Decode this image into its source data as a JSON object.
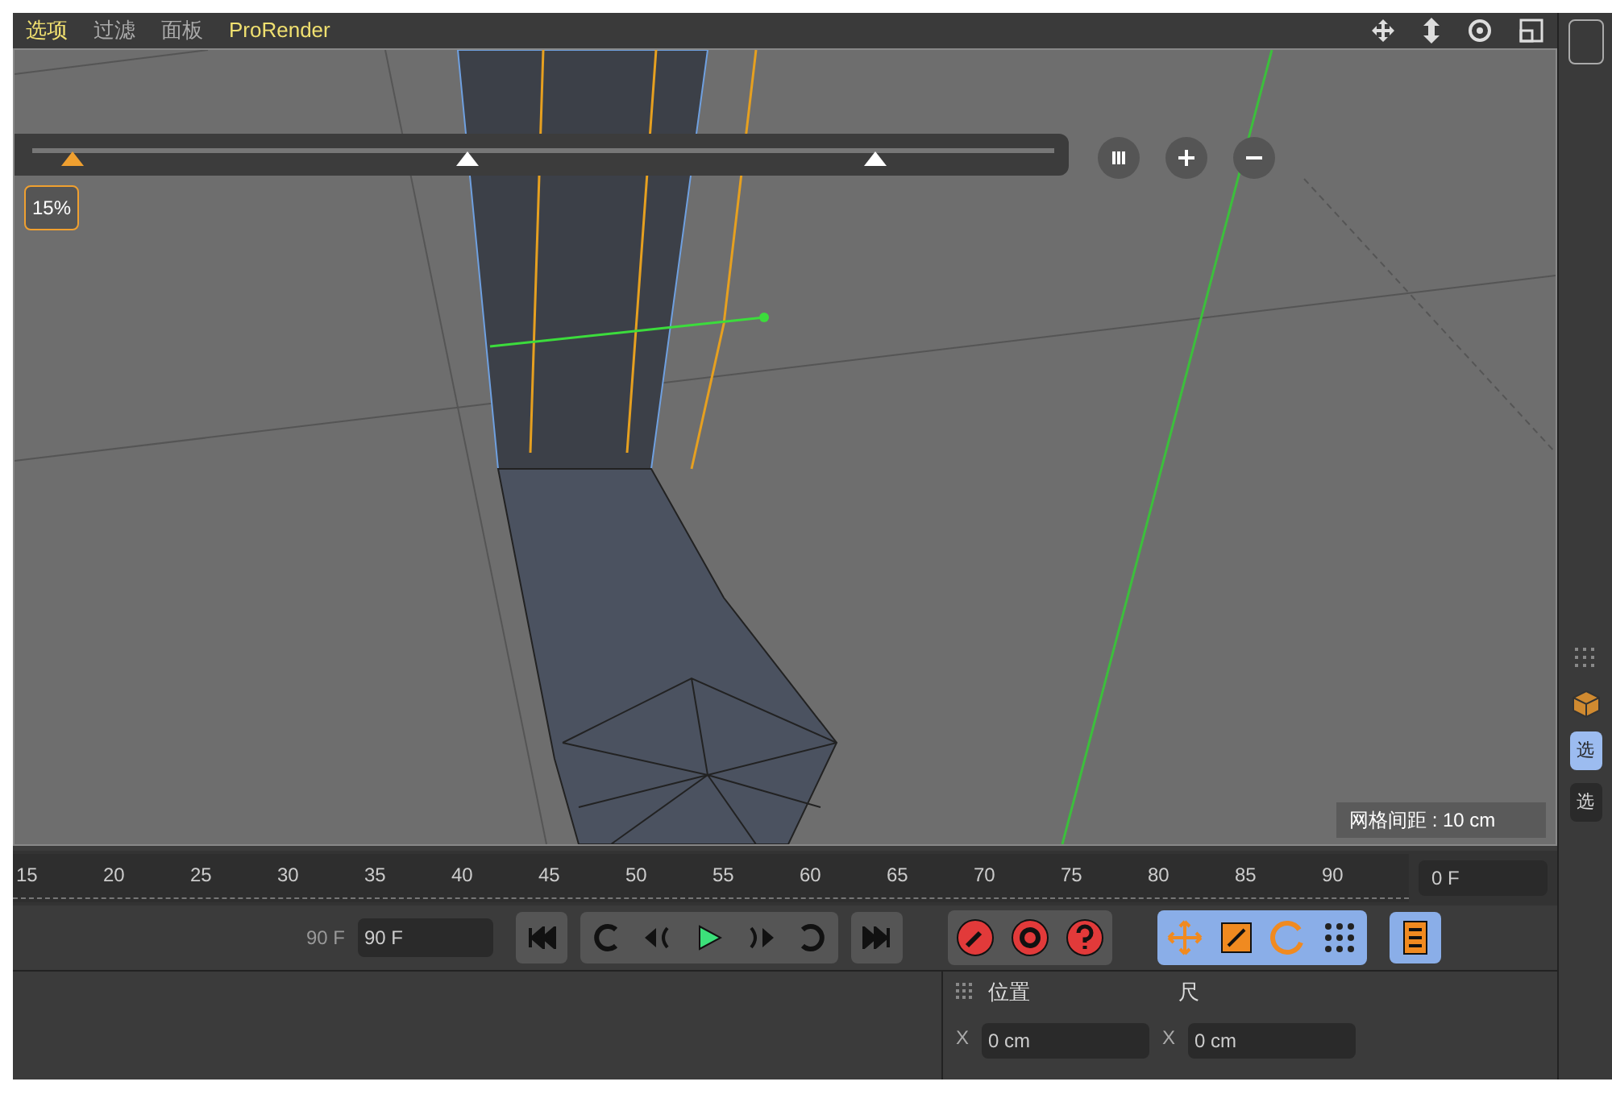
{
  "menu": [
    {
      "label": "选项",
      "highlighted": true
    },
    {
      "label": "过滤",
      "highlighted": false
    },
    {
      "label": "面板",
      "highlighted": false
    },
    {
      "label": "ProRender",
      "highlighted": true
    }
  ],
  "viewport": {
    "slider": {
      "level": 0.04,
      "reading": "15%"
    },
    "grid_label": "网格间距 : 10 cm"
  },
  "timeline": {
    "ticks": [
      "15",
      "20",
      "25",
      "30",
      "35",
      "40",
      "45",
      "50",
      "55",
      "60",
      "65",
      "70",
      "75",
      "80",
      "85",
      "90"
    ],
    "current_frame": "0 F"
  },
  "transport": {
    "end_frame_label": "90 F",
    "end_frame_field": "90 F"
  },
  "coordinates": {
    "header": "位置",
    "header_2": "尺",
    "fields": [
      {
        "axis": "X",
        "value": "0 cm"
      },
      {
        "axis": "X",
        "value": "0 cm"
      }
    ]
  },
  "side_tabs": [
    {
      "label": "选",
      "selected": true
    },
    {
      "label": "选",
      "selected": false
    }
  ]
}
